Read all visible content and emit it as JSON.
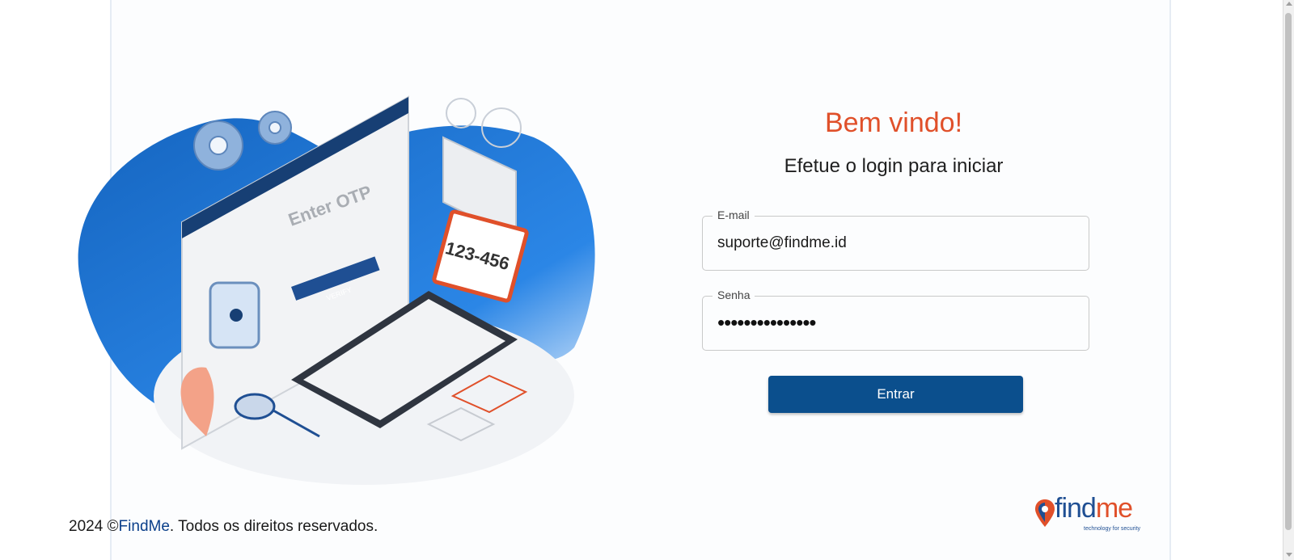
{
  "welcome": {
    "title": "Bem vindo!",
    "subtitle": "Efetue o login para iniciar"
  },
  "form": {
    "email_label": "E-mail",
    "email_value": "suporte@findme.id",
    "password_label": "Senha",
    "password_value": "•••••••••••••••",
    "submit_label": "Entrar"
  },
  "illustration": {
    "heading": "Enter OTP",
    "verify_label": "VERIFY",
    "otp_code": "123-456"
  },
  "footer": {
    "year": "2024 ©",
    "brand_link": "FindMe",
    "rights": ". Todos os direitos reservados."
  },
  "logo": {
    "find": "find",
    "me": "me",
    "tagline": "technology for security"
  },
  "colors": {
    "accent": "#e0502a",
    "primary": "#0b4f8d",
    "brand_blue": "#1f4f93"
  }
}
